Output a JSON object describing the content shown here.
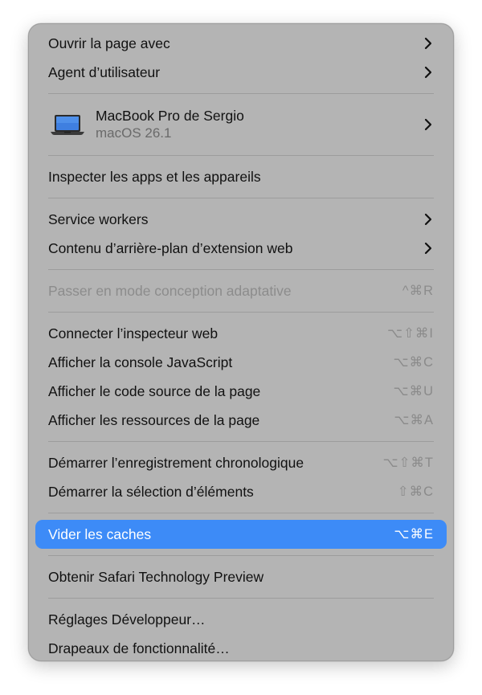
{
  "menu": {
    "open_with": "Ouvrir la page avec",
    "user_agent": "Agent d’utilisateur",
    "device": {
      "name": "MacBook Pro de Sergio",
      "os": "macOS 26.1",
      "icon": "laptop-icon"
    },
    "inspect_apps": "Inspecter les apps et les appareils",
    "service_workers": "Service workers",
    "extension_background": "Contenu d’arrière-plan d’extension web",
    "responsive_mode": {
      "label": "Passer en mode conception adaptative",
      "shortcut": "^⌘R"
    },
    "connect_inspector": {
      "label": "Connecter l’inspecteur web",
      "shortcut": "⌥⇧⌘I"
    },
    "show_console": {
      "label": "Afficher la console JavaScript",
      "shortcut": "⌥⌘C"
    },
    "show_source": {
      "label": "Afficher le code source de la page",
      "shortcut": "⌥⌘U"
    },
    "show_resources": {
      "label": "Afficher les ressources de la page",
      "shortcut": "⌥⌘A"
    },
    "start_timeline": {
      "label": "Démarrer l’enregistrement chronologique",
      "shortcut": "⌥⇧⌘T"
    },
    "start_element_selection": {
      "label": "Démarrer la sélection d’éléments",
      "shortcut": "⇧⌘C"
    },
    "empty_caches": {
      "label": "Vider les caches",
      "shortcut": "⌥⌘E"
    },
    "get_stp": "Obtenir Safari Technology Preview",
    "developer_settings": "Réglages Développeur…",
    "feature_flags": "Drapeaux de fonctionnalité…"
  },
  "colors": {
    "menu_background": "#b4b4b4",
    "selection": "#3d8bf7",
    "disabled_text": "#8c8c8c"
  }
}
